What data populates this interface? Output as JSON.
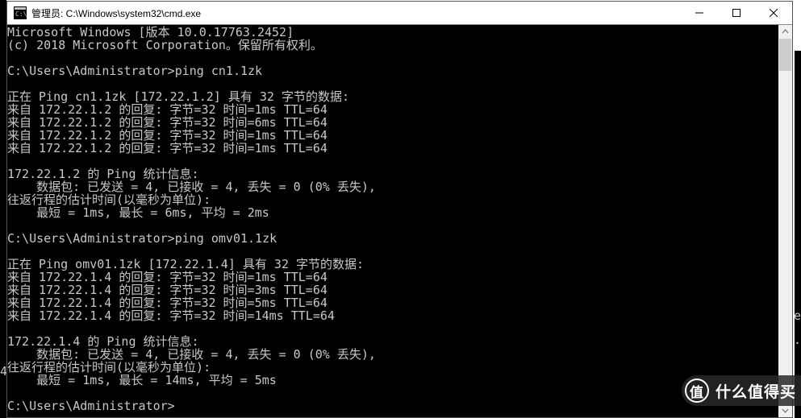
{
  "window": {
    "title": "管理员: C:\\Windows\\system32\\cmd.exe"
  },
  "terminal": {
    "lines": [
      "Microsoft Windows [版本 10.0.17763.2452]",
      "(c) 2018 Microsoft Corporation。保留所有权利。",
      "",
      "C:\\Users\\Administrator>ping cn1.1zk",
      "",
      "正在 Ping cn1.1zk [172.22.1.2] 具有 32 字节的数据:",
      "来自 172.22.1.2 的回复: 字节=32 时间=1ms TTL=64",
      "来自 172.22.1.2 的回复: 字节=32 时间=6ms TTL=64",
      "来自 172.22.1.2 的回复: 字节=32 时间=1ms TTL=64",
      "来自 172.22.1.2 的回复: 字节=32 时间=1ms TTL=64",
      "",
      "172.22.1.2 的 Ping 统计信息:",
      "    数据包: 已发送 = 4, 已接收 = 4, 丢失 = 0 (0% 丢失),",
      "往返行程的估计时间(以毫秒为单位):",
      "    最短 = 1ms, 最长 = 6ms, 平均 = 2ms",
      "",
      "C:\\Users\\Administrator>ping omv01.1zk",
      "",
      "正在 Ping omv01.1zk [172.22.1.4] 具有 32 字节的数据:",
      "来自 172.22.1.4 的回复: 字节=32 时间=1ms TTL=64",
      "来自 172.22.1.4 的回复: 字节=32 时间=3ms TTL=64",
      "来自 172.22.1.4 的回复: 字节=32 时间=5ms TTL=64",
      "来自 172.22.1.4 的回复: 字节=32 时间=14ms TTL=64",
      "",
      "172.22.1.4 的 Ping 统计信息:",
      "    数据包: 已发送 = 4, 已接收 = 4, 丢失 = 0 (0% 丢失),",
      "往返行程的估计时间(以毫秒为单位):",
      "    最短 = 1ms, 最长 = 14ms, 平均 = 5ms",
      "",
      "C:\\Users\\Administrator>"
    ]
  },
  "watermark": {
    "badge": "值",
    "text": "什么值得买"
  },
  "edges": {
    "left_char": "4",
    "right_char1": "e",
    "right_char2": "."
  }
}
